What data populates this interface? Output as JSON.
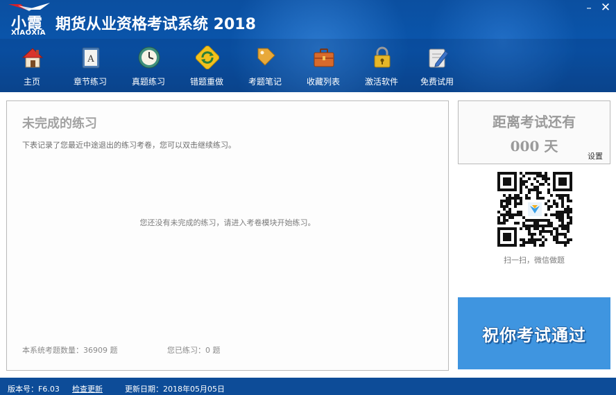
{
  "app": {
    "logo_cn": "小霞",
    "logo_en": "XIAOXIA",
    "title": "期货从业资格考试系统 2018",
    "window_buttons": {
      "minimize": "–",
      "close": "✕"
    }
  },
  "nav": [
    {
      "label": "主页",
      "icon": "home-icon"
    },
    {
      "label": "章节练习",
      "icon": "book-icon"
    },
    {
      "label": "真题练习",
      "icon": "clock-icon"
    },
    {
      "label": "错题重做",
      "icon": "refresh-icon"
    },
    {
      "label": "考题笔记",
      "icon": "tag-icon"
    },
    {
      "label": "收藏列表",
      "icon": "briefcase-icon"
    },
    {
      "label": "激活软件",
      "icon": "lock-icon"
    },
    {
      "label": "免费试用",
      "icon": "pencil-icon"
    }
  ],
  "main": {
    "title": "未完成的练习",
    "description": "下表记录了您最近中途退出的练习考卷，您可以双击继续练习。",
    "empty_message": "您还没有未完成的练习，请进入考卷模块开始练习。",
    "total_questions": "本系统考题数量：36909 题",
    "practiced": "您已练习：0 题"
  },
  "countdown": {
    "label": "距离考试还有",
    "days": "000 天",
    "settings": "设置"
  },
  "qr": {
    "caption": "扫一扫，微信做题"
  },
  "banner": {
    "text": "祝你考试通过"
  },
  "footer": {
    "version": "版本号：F6.03",
    "check_update": "检查更新",
    "update_date": "更新日期：2018年05月05日"
  },
  "colors": {
    "header": "#0a56ad",
    "footer": "#0d4c98",
    "banner": "#3f95e0"
  }
}
